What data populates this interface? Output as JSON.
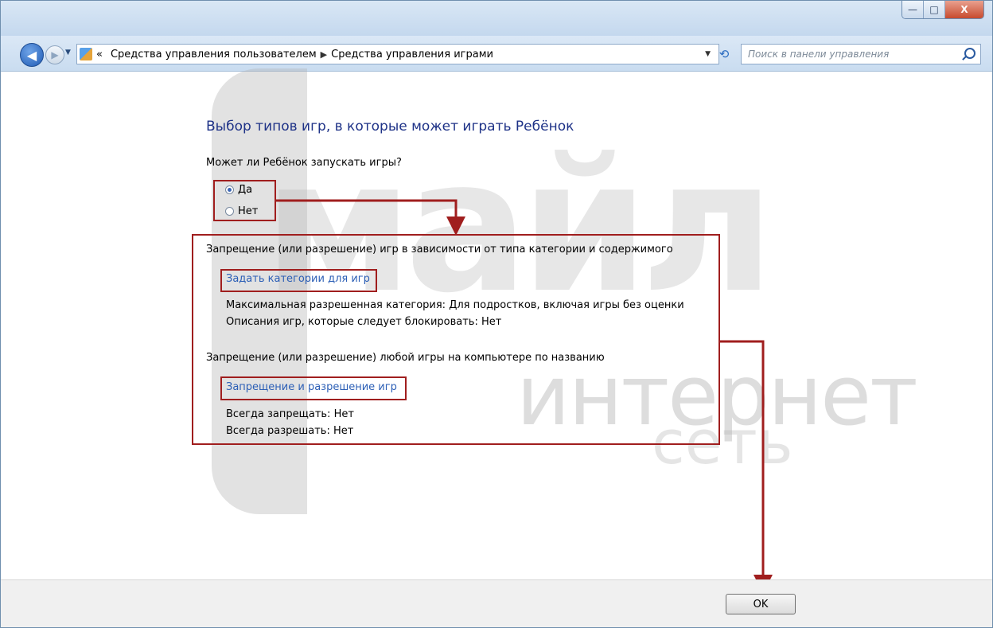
{
  "titlebar": {
    "minimize_label": "—",
    "maximize_label": "□",
    "close_label": "X"
  },
  "nav": {
    "back_icon": "back-arrow-icon",
    "forward_icon": "forward-arrow-icon",
    "breadcrumb_prefix": "«",
    "breadcrumb": [
      "Средства управления пользователем",
      "Средства управления играми"
    ],
    "search_placeholder": "Поиск в панели управления"
  },
  "main": {
    "heading": "Выбор типов игр, в которые может играть Ребёнок",
    "question": "Может ли Ребёнок запускать игры?",
    "options": [
      {
        "label": "Да",
        "selected": true
      },
      {
        "label": "Нет",
        "selected": false
      }
    ],
    "section1": {
      "title": "Запрещение (или разрешение) игр в зависимости от типа категории и содержимого",
      "link": "Задать категории для игр",
      "line1": "Максимальная разрешенная категория:  Для подростков, включая игры без оценки",
      "line2": "Описания игр, которые следует блокировать:  Нет"
    },
    "section2": {
      "title": "Запрещение (или разрешение) любой игры на компьютере по названию",
      "link": "Запрещение и разрешение игр",
      "line1": "Всегда запрещать:  Нет",
      "line2": "Всегда разрешать:  Нет"
    }
  },
  "footer": {
    "ok_label": "OK"
  },
  "watermark": {
    "big": "майл",
    "mid": "интернет",
    "small": "сеть"
  },
  "colors": {
    "heading": "#1e3287",
    "link": "#2c5fb6",
    "highlight": "#a01e1e"
  }
}
